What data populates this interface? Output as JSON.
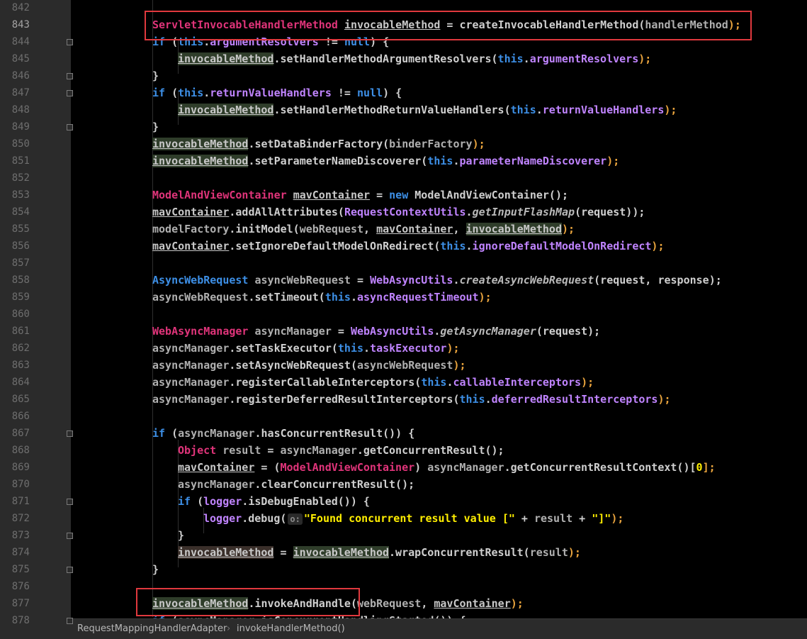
{
  "editor": {
    "current_line": 843,
    "lines": [
      {
        "n": "842",
        "code": []
      },
      {
        "n": "843",
        "code": [
          [
            "ServletInvocableHandlerMethod",
            "t"
          ],
          [
            " ",
            "p"
          ],
          [
            "invocableMethod",
            "m u"
          ],
          [
            " = createInvocableHandlerMethod(",
            "p"
          ],
          [
            "handlerMethod",
            "i"
          ],
          [
            ");",
            "pn"
          ]
        ]
      },
      {
        "n": "844",
        "code": [
          [
            "if",
            "k"
          ],
          [
            " (",
            "p"
          ],
          [
            "this",
            "k"
          ],
          [
            ".",
            "p"
          ],
          [
            "argumentResolvers",
            "f"
          ],
          [
            " != ",
            "p"
          ],
          [
            "null",
            "k"
          ],
          [
            ") {",
            "p"
          ]
        ]
      },
      {
        "n": "845",
        "code": [
          [
            "invocableMethod",
            "m u hl"
          ],
          [
            ".setHandlerMethodArgumentResolvers(",
            "p"
          ],
          [
            "this",
            "k"
          ],
          [
            ".",
            "p"
          ],
          [
            "argumentResolvers",
            "f"
          ],
          [
            ");",
            "pn"
          ]
        ]
      },
      {
        "n": "846",
        "code": [
          [
            "}",
            "p"
          ]
        ]
      },
      {
        "n": "847",
        "code": [
          [
            "if",
            "k"
          ],
          [
            " (",
            "p"
          ],
          [
            "this",
            "k"
          ],
          [
            ".",
            "p"
          ],
          [
            "returnValueHandlers",
            "f"
          ],
          [
            " != ",
            "p"
          ],
          [
            "null",
            "k"
          ],
          [
            ") {",
            "p"
          ]
        ]
      },
      {
        "n": "848",
        "code": [
          [
            "invocableMethod",
            "m u hl"
          ],
          [
            ".setHandlerMethodReturnValueHandlers(",
            "p"
          ],
          [
            "this",
            "k"
          ],
          [
            ".",
            "p"
          ],
          [
            "returnValueHandlers",
            "f"
          ],
          [
            ");",
            "pn"
          ]
        ]
      },
      {
        "n": "849",
        "code": [
          [
            "}",
            "p"
          ]
        ]
      },
      {
        "n": "850",
        "code": [
          [
            "invocableMethod",
            "m u hl"
          ],
          [
            ".setDataBinderFactory(",
            "p"
          ],
          [
            "binderFactory",
            "i"
          ],
          [
            ");",
            "pn"
          ]
        ]
      },
      {
        "n": "851",
        "code": [
          [
            "invocableMethod",
            "m u hl"
          ],
          [
            ".setParameterNameDiscoverer(",
            "p"
          ],
          [
            "this",
            "k"
          ],
          [
            ".",
            "p"
          ],
          [
            "parameterNameDiscoverer",
            "f"
          ],
          [
            ");",
            "pn"
          ]
        ]
      },
      {
        "n": "852",
        "code": []
      },
      {
        "n": "853",
        "code": [
          [
            "ModelAndViewContainer",
            "t"
          ],
          [
            " ",
            "p"
          ],
          [
            "mavContainer",
            "m u"
          ],
          [
            " = ",
            "p"
          ],
          [
            "new",
            "k"
          ],
          [
            " ModelAndViewContainer();",
            "p"
          ]
        ]
      },
      {
        "n": "854",
        "code": [
          [
            "mavContainer",
            "m u"
          ],
          [
            ".addAllAttributes(",
            "p"
          ],
          [
            "RequestContextUtils",
            "f"
          ],
          [
            ".",
            "p"
          ],
          [
            "getInputFlashMap",
            "st"
          ],
          [
            "(request));",
            "p"
          ]
        ]
      },
      {
        "n": "855",
        "code": [
          [
            "modelFactory",
            "i"
          ],
          [
            ".initModel(",
            "p"
          ],
          [
            "webRequest",
            "i"
          ],
          [
            ", ",
            "p"
          ],
          [
            "mavContainer",
            "m u"
          ],
          [
            ", ",
            "p"
          ],
          [
            "invocableMethod",
            "m u hl"
          ],
          [
            ");",
            "pn"
          ]
        ]
      },
      {
        "n": "856",
        "code": [
          [
            "mavContainer",
            "m u"
          ],
          [
            ".setIgnoreDefaultModelOnRedirect(",
            "p"
          ],
          [
            "this",
            "k"
          ],
          [
            ".",
            "p"
          ],
          [
            "ignoreDefaultModelOnRedirect",
            "f"
          ],
          [
            ");",
            "pn"
          ]
        ]
      },
      {
        "n": "857",
        "code": []
      },
      {
        "n": "858",
        "code": [
          [
            "AsyncWebRequest",
            "k"
          ],
          [
            " ",
            "p"
          ],
          [
            "asyncWebRequest",
            "i"
          ],
          [
            " = ",
            "p"
          ],
          [
            "WebAsyncUtils",
            "f"
          ],
          [
            ".",
            "p"
          ],
          [
            "createAsyncWebRequest",
            "st"
          ],
          [
            "(request, response);",
            "p"
          ]
        ]
      },
      {
        "n": "859",
        "code": [
          [
            "asyncWebRequest",
            "i"
          ],
          [
            ".setTimeout(",
            "p"
          ],
          [
            "this",
            "k"
          ],
          [
            ".",
            "p"
          ],
          [
            "asyncRequestTimeout",
            "f"
          ],
          [
            ");",
            "pn"
          ]
        ]
      },
      {
        "n": "860",
        "code": []
      },
      {
        "n": "861",
        "code": [
          [
            "WebAsyncManager",
            "t"
          ],
          [
            " ",
            "p"
          ],
          [
            "asyncManager",
            "i"
          ],
          [
            " = ",
            "p"
          ],
          [
            "WebAsyncUtils",
            "f"
          ],
          [
            ".",
            "p"
          ],
          [
            "getAsyncManager",
            "st"
          ],
          [
            "(request);",
            "p"
          ]
        ]
      },
      {
        "n": "862",
        "code": [
          [
            "asyncManager",
            "i"
          ],
          [
            ".setTaskExecutor(",
            "p"
          ],
          [
            "this",
            "k"
          ],
          [
            ".",
            "p"
          ],
          [
            "taskExecutor",
            "f"
          ],
          [
            ");",
            "pn"
          ]
        ]
      },
      {
        "n": "863",
        "code": [
          [
            "asyncManager",
            "i"
          ],
          [
            ".setAsyncWebRequest(",
            "p"
          ],
          [
            "asyncWebRequest",
            "i"
          ],
          [
            ");",
            "pn"
          ]
        ]
      },
      {
        "n": "864",
        "code": [
          [
            "asyncManager",
            "i"
          ],
          [
            ".registerCallableInterceptors(",
            "p"
          ],
          [
            "this",
            "k"
          ],
          [
            ".",
            "p"
          ],
          [
            "callableInterceptors",
            "f"
          ],
          [
            ");",
            "pn"
          ]
        ]
      },
      {
        "n": "865",
        "code": [
          [
            "asyncManager",
            "i"
          ],
          [
            ".registerDeferredResultInterceptors(",
            "p"
          ],
          [
            "this",
            "k"
          ],
          [
            ".",
            "p"
          ],
          [
            "deferredResultInterceptors",
            "f"
          ],
          [
            ");",
            "pn"
          ]
        ]
      },
      {
        "n": "866",
        "code": []
      },
      {
        "n": "867",
        "code": [
          [
            "if",
            "k"
          ],
          [
            " (",
            "p"
          ],
          [
            "asyncManager",
            "i"
          ],
          [
            ".hasConcurrentResult()) {",
            "p"
          ]
        ]
      },
      {
        "n": "868",
        "code": [
          [
            "Object",
            "t"
          ],
          [
            " ",
            "p"
          ],
          [
            "result",
            "i"
          ],
          [
            " = ",
            "p"
          ],
          [
            "asyncManager",
            "i"
          ],
          [
            ".getConcurrentResult();",
            "p"
          ]
        ]
      },
      {
        "n": "869",
        "code": [
          [
            "mavContainer",
            "m u"
          ],
          [
            " = (",
            "p"
          ],
          [
            "ModelAndViewContainer",
            "t"
          ],
          [
            ") ",
            "p"
          ],
          [
            "asyncManager",
            "i"
          ],
          [
            ".getConcurrentResultContext()[",
            "p"
          ],
          [
            "0",
            "s"
          ],
          [
            "];",
            "pn"
          ]
        ]
      },
      {
        "n": "870",
        "code": [
          [
            "asyncManager",
            "i"
          ],
          [
            ".clearConcurrentResult();",
            "p"
          ]
        ]
      },
      {
        "n": "871",
        "code": [
          [
            "if",
            "k"
          ],
          [
            " (",
            "p"
          ],
          [
            "logger",
            "f"
          ],
          [
            ".isDebugEnabled()) {",
            "p"
          ]
        ]
      },
      {
        "n": "872",
        "code": [
          [
            "logger",
            "f"
          ],
          [
            ".debug(",
            "p"
          ],
          [
            "HINT",
            "hint"
          ],
          [
            "\"Found concurrent result value [\"",
            "s"
          ],
          [
            " + ",
            "p"
          ],
          [
            "result",
            "i"
          ],
          [
            " + ",
            "p"
          ],
          [
            "\"]\"",
            "s"
          ],
          [
            ");",
            "pn"
          ]
        ]
      },
      {
        "n": "873",
        "code": [
          [
            "}",
            "p"
          ]
        ]
      },
      {
        "n": "874",
        "code": [
          [
            "invocableMethod",
            "m u hw"
          ],
          [
            " = ",
            "p"
          ],
          [
            "invocableMethod",
            "m u hl"
          ],
          [
            ".wrapConcurrentResult(",
            "p"
          ],
          [
            "result",
            "i"
          ],
          [
            ");",
            "pn"
          ]
        ]
      },
      {
        "n": "875",
        "code": [
          [
            "}",
            "p"
          ]
        ]
      },
      {
        "n": "876",
        "code": []
      },
      {
        "n": "877",
        "code": [
          [
            "invocableMethod",
            "m u hl"
          ],
          [
            ".invokeAndHandle(",
            "p"
          ],
          [
            "webRequest",
            "i"
          ],
          [
            ", ",
            "p"
          ],
          [
            "mavContainer",
            "m u"
          ],
          [
            ");",
            "pn"
          ]
        ]
      },
      {
        "n": "878",
        "code": [
          [
            "if",
            "k"
          ],
          [
            " (",
            "p"
          ],
          [
            "asyncManager",
            "i"
          ],
          [
            ".isConcurrentHandlingStarted()) {",
            "p"
          ]
        ]
      }
    ],
    "param_hint": "o:"
  },
  "breadcrumb": {
    "class_name": "RequestMappingHandlerAdapter",
    "separator": "›",
    "method_name": "invokeHandlerMethod()"
  },
  "colors": {
    "keyword": "#3d8fe6",
    "type": "#e0347a",
    "field": "#c084ff",
    "string": "#ffee00",
    "highlight_box": "#e0393e"
  }
}
